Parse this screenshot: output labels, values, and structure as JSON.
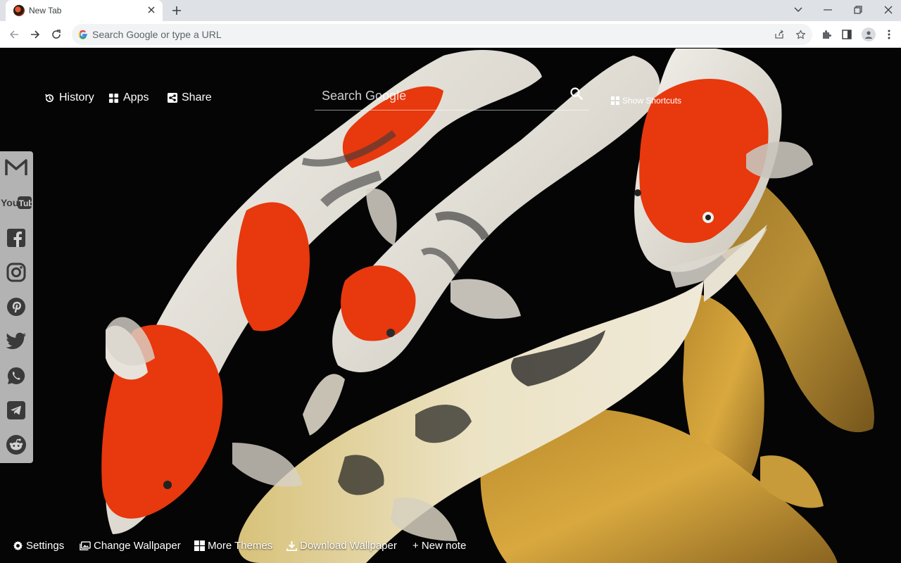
{
  "browser": {
    "tab": {
      "title": "New Tab"
    },
    "omnibox": {
      "placeholder": "Search Google or type a URL"
    }
  },
  "newtab": {
    "topnav": {
      "history": "History",
      "apps": "Apps",
      "share": "Share"
    },
    "search": {
      "placeholder": "Search Google"
    },
    "shortcuts_label": "Show Shortcuts",
    "social": [
      "gmail",
      "youtube",
      "facebook",
      "instagram",
      "pinterest",
      "twitter",
      "whatsapp",
      "telegram",
      "reddit"
    ],
    "bottom": {
      "settings": "Settings",
      "change_wallpaper": "Change Wallpaper",
      "more_themes": "More Themes",
      "download_wallpaper": "Download Wallpaper",
      "new_note": "+ New note"
    }
  },
  "colors": {
    "koi_red": "#e8380d",
    "koi_white": "#e9e6df",
    "koi_gold": "#d9a93f",
    "sidebar": "#d2d2d2"
  }
}
